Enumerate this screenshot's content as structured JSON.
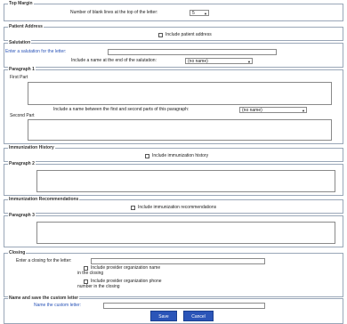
{
  "top_margin": {
    "legend": "Top Margin",
    "label": "Number of blank lines at the top of the letter:",
    "value": "5"
  },
  "patient_address": {
    "legend": "Patient Address",
    "checkbox_label": "Include patient address"
  },
  "salutation": {
    "legend": "Salutation",
    "enter_label": "Enter a salutation for the letter:",
    "include_label": "Include a name at the end of the salutation:",
    "select_value": "(no name)"
  },
  "paragraph1": {
    "legend": "Paragraph 1",
    "first_part_label": "First Part",
    "between_label": "Include a name between the first and second parts of this paragraph:",
    "between_value": "(no name)",
    "second_part_label": "Second Part"
  },
  "immunization_history": {
    "legend": "Immunization History",
    "checkbox_label": "Include immunization history"
  },
  "paragraph2": {
    "legend": "Paragraph 2"
  },
  "immunization_recommendations": {
    "legend": "Immunization Recommendations",
    "checkbox_label": "Include immunization recommendations"
  },
  "paragraph3": {
    "legend": "Paragraph 3"
  },
  "closing": {
    "legend": "Closing",
    "enter_label": "Enter a closing for the letter:",
    "org_name_line1": "Include provider organization name",
    "org_name_line2": "in the closing",
    "org_phone_line1": "Include provider organization phone",
    "org_phone_line2": "number in the closing"
  },
  "name_save": {
    "legend": "Name and save the custom letter",
    "name_label": "Name the custom letter:"
  },
  "buttons": {
    "save": "Save",
    "cancel": "Cancel"
  },
  "icons": {
    "dropdown": "chevron-down-icon"
  },
  "colors": {
    "accent": "#2b55b8",
    "label_blue": "#2a54b8",
    "border": "#9aa7b8"
  }
}
